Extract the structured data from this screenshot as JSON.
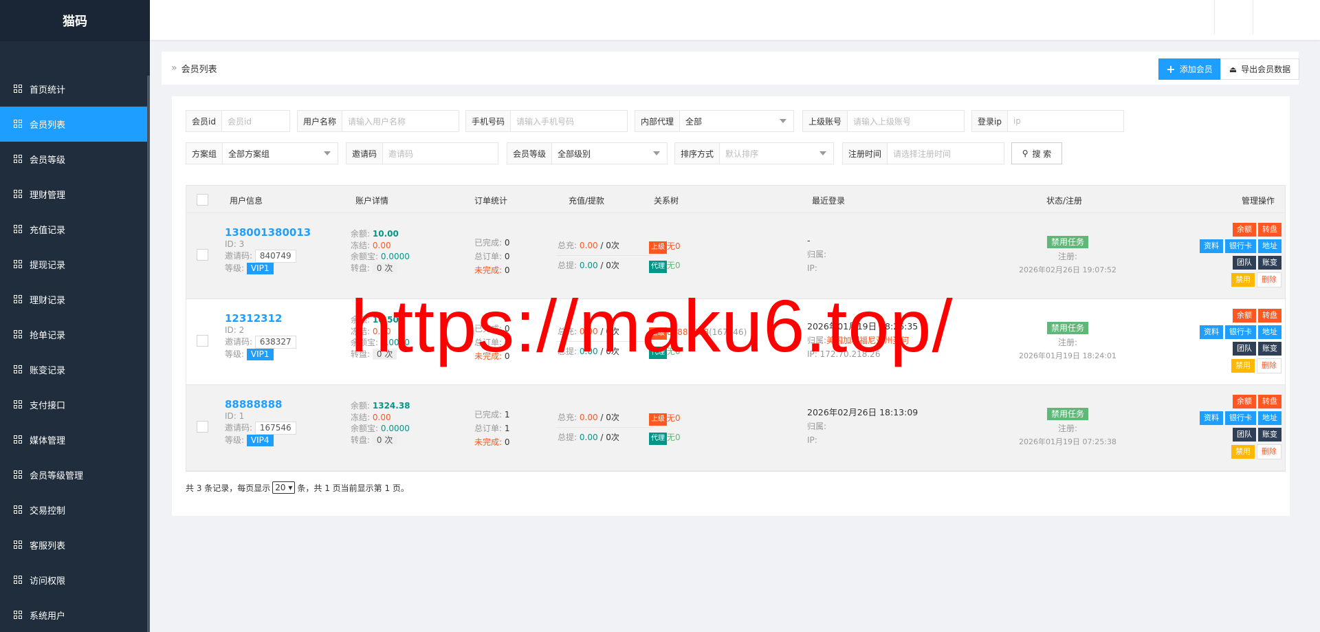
{
  "app_title": "猫码",
  "menu": [
    {
      "label": "首页统计"
    },
    {
      "label": "会员列表",
      "active": true
    },
    {
      "label": "会员等级"
    },
    {
      "label": "理财管理"
    },
    {
      "label": "充值记录"
    },
    {
      "label": "提现记录"
    },
    {
      "label": "理财记录"
    },
    {
      "label": "抢单记录"
    },
    {
      "label": "账变记录"
    },
    {
      "label": "支付接口"
    },
    {
      "label": "媒体管理"
    },
    {
      "label": "会员等级管理"
    },
    {
      "label": "交易控制"
    },
    {
      "label": "客服列表"
    },
    {
      "label": "访问权限"
    },
    {
      "label": "系统用户"
    }
  ],
  "breadcrumb": {
    "arrow": "»",
    "label": "会员列表"
  },
  "toolbar": {
    "add_label": "添加会员",
    "add_icon": "plus-icon",
    "export_label": "导出会员数据",
    "export_icon": "export-icon"
  },
  "filters": {
    "member_id": {
      "label": "会员id",
      "placeholder": "会员id"
    },
    "username": {
      "label": "用户名称",
      "placeholder": "请输入用户名称"
    },
    "phone": {
      "label": "手机号码",
      "placeholder": "请输入手机号码"
    },
    "agent": {
      "label": "内部代理",
      "value": "全部"
    },
    "parent": {
      "label": "上级账号",
      "placeholder": "请输入上级账号"
    },
    "login_ip": {
      "label": "登录ip",
      "placeholder": "ip"
    },
    "plan": {
      "label": "方案组",
      "value": "全部方案组"
    },
    "invite": {
      "label": "邀请码",
      "placeholder": "邀请码"
    },
    "level": {
      "label": "会员等级",
      "value": "全部级别"
    },
    "sort": {
      "label": "排序方式",
      "value": "默认排序"
    },
    "reg_time": {
      "label": "注册时间",
      "placeholder": "请选择注册时间"
    },
    "search_label": "搜 索"
  },
  "table": {
    "headers": [
      "用户信息",
      "账户详情",
      "订单统计",
      "充值/提款",
      "关系树",
      "最近登录",
      "状态/注册",
      "管理操作"
    ],
    "labels": {
      "id": "ID:",
      "invite": "邀请码:",
      "level": "等级:",
      "balance": "余额:",
      "frozen": "冻结:",
      "yuebao": "余额宝:",
      "spin": "转盘:",
      "done": "已完成:",
      "total": "总订单:",
      "undone": "未完成:",
      "recharge": "总充:",
      "withdraw": "总提:",
      "times_suffix": "次",
      "upper": "上级",
      "agent": "代理",
      "login_loc": "归属:",
      "login_ip": "IP:",
      "status": "禁用任务",
      "reg": "注册:"
    },
    "ops": [
      "余额",
      "转盘",
      "资料",
      "银行卡",
      "地址",
      "团队",
      "账变",
      "禁用",
      "删除"
    ],
    "rows": [
      {
        "phone": "138001380013",
        "id": "3",
        "invite": "840749",
        "level": "VIP1",
        "balance": "10.00",
        "frozen": "0.00",
        "yuebao": "0.0000",
        "spin": "0 次",
        "done": "0",
        "total": "0",
        "undone": "0",
        "recharge": "0.00",
        "recharge_count": "0次",
        "withdraw": "0.00",
        "withdraw_count": "0次",
        "upper": "无0",
        "agent": "无0",
        "last_login": "-",
        "login_loc": "",
        "login_ip": "",
        "reg_time": "2026年02月26日 19:07:52"
      },
      {
        "phone": "12312312",
        "id": "2",
        "invite": "638327",
        "level": "VIP1",
        "balance": "10.50",
        "frozen": "0.00",
        "yuebao": "0.0000",
        "spin": "0 次",
        "done": "0",
        "total": "0",
        "undone": "0",
        "recharge": "0.00",
        "recharge_count": "0次",
        "withdraw": "0.00",
        "withdraw_count": "0次",
        "upper": "88888888",
        "upper_sub": "(167546)",
        "agent": "无0",
        "last_login": "2026年01月19日 18:26:35",
        "login_loc": "美国加利福尼亚州圣何",
        "login_ip": "172.70.218.26",
        "reg_time": "2026年01月19日 18:24:01"
      },
      {
        "phone": "88888888",
        "id": "1",
        "invite": "167546",
        "level": "VIP4",
        "balance": "1324.38",
        "frozen": "0.00",
        "yuebao": "0.0000",
        "spin": "0 次",
        "done": "1",
        "total": "1",
        "undone": "0",
        "recharge": "0.00",
        "recharge_count": "0次",
        "withdraw": "0.00",
        "withdraw_count": "0次",
        "upper": "无0",
        "agent": "无0",
        "last_login": "2026年02月26日 18:13:09",
        "login_loc": "",
        "login_ip": "",
        "reg_time": "2026年01月19日 07:25:38"
      }
    ]
  },
  "pager": {
    "prefix": "共 3 条记录，每页显示",
    "page_size": "20",
    "suffix": "条，共 1 页当前显示第 1 页。"
  },
  "watermark": "https://maku6.top/"
}
